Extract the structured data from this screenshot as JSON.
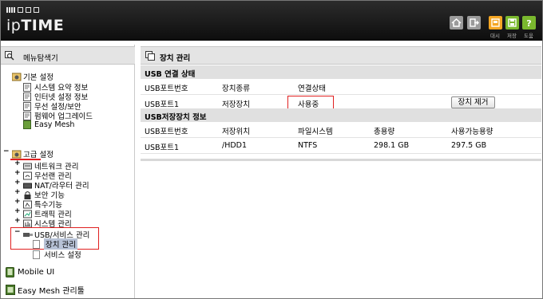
{
  "header": {
    "logo": "ipTIME",
    "buttons": [
      {
        "name": "home",
        "label": ""
      },
      {
        "name": "logout",
        "label": ""
      },
      {
        "name": "save",
        "label": "대시"
      },
      {
        "name": "storage",
        "label": "저장"
      },
      {
        "name": "help",
        "label": "도움"
      }
    ],
    "colors": {
      "orange": "#f5a623",
      "green": "#7ab82e",
      "gray": "#9a9a9a"
    }
  },
  "sidebar": {
    "title": "메뉴탐색기",
    "basic": {
      "label": "기본 설정",
      "children": [
        "시스템 요약 정보",
        "인터넷 설정 정보",
        "무선 설정/보안",
        "펌웨어 업그레이드",
        "Easy Mesh"
      ]
    },
    "advanced": {
      "label": "고급 설정",
      "children": [
        "네트워크 관리",
        "무선랜 관리",
        "NAT/라우터 관리",
        "보안 기능",
        "특수기능",
        "트래픽 관리",
        "시스템 관리"
      ]
    },
    "usb": {
      "label": "USB/서비스 관리",
      "children": [
        "장치 관리",
        "서비스 설정"
      ]
    },
    "bottom": [
      "Mobile UI",
      "Easy Mesh 관리툴"
    ]
  },
  "main": {
    "title": "장치 관리",
    "usb_status": {
      "heading": "USB 연결 상태",
      "columns": [
        "USB포트번호",
        "장치종류",
        "연결상태"
      ],
      "row": {
        "port": "USB포트1",
        "type": "저장장치",
        "status": "사용중",
        "button": "장치 제거"
      }
    },
    "storage_info": {
      "heading": "USB저장장치 정보",
      "columns": [
        "USB포트번호",
        "저장위치",
        "파일시스템",
        "총용량",
        "사용가능용량"
      ],
      "row": {
        "port": "USB포트1",
        "location": "/HDD1",
        "fs": "NTFS",
        "total": "298.1 GB",
        "available": "297.5 GB"
      }
    }
  }
}
